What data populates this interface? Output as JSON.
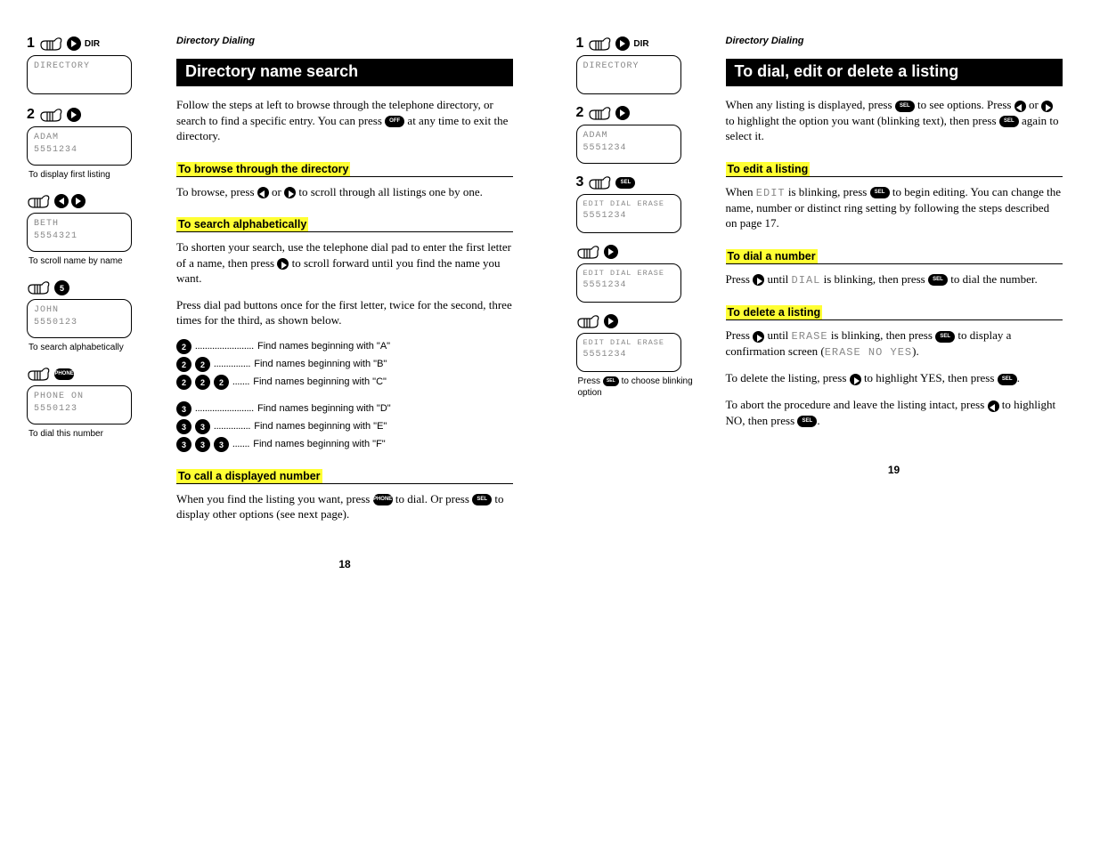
{
  "page_left": {
    "breadcrumb": "Directory Dialing",
    "title": "Directory name search",
    "intro_1": "Follow the steps at left to browse through the telephone directory, or search to find a specific entry. You can press ",
    "intro_off": "OFF",
    "intro_2": " at any time to exit the directory.",
    "sections": {
      "browse": {
        "head": "To browse through the directory",
        "body_1": "To browse, press ",
        "body_2": " or ",
        "body_3": " to scroll through all listings one by one."
      },
      "search": {
        "head": "To search alphabetically",
        "body_a1": "To shorten your search, use the telephone dial pad to enter the first letter of a name, then press ",
        "body_a2": " to scroll forward until you find the name you want.",
        "body_b": "Press dial pad buttons once for the first letter, twice for the second, three times for the third, as shown below.",
        "rows": [
          {
            "keys": [
              "2"
            ],
            "text": "Find names beginning with \"A\""
          },
          {
            "keys": [
              "2",
              "2"
            ],
            "text": "Find names beginning with \"B\""
          },
          {
            "keys": [
              "2",
              "2",
              "2"
            ],
            "text": "Find names beginning with \"C\""
          },
          {
            "keys": [
              "3"
            ],
            "text": "Find names beginning with \"D\""
          },
          {
            "keys": [
              "3",
              "3"
            ],
            "text": "Find names beginning with \"E\""
          },
          {
            "keys": [
              "3",
              "3",
              "3"
            ],
            "text": "Find names beginning with \"F\""
          }
        ]
      },
      "call": {
        "head": "To call a displayed number",
        "body_1": "When you find the listing you want, press ",
        "phone": "PHONE",
        "body_2": " to dial. Or press ",
        "sel": "SEL",
        "body_3": " to display other options (see next page)."
      }
    },
    "margin": [
      {
        "num": "1",
        "icons": "dir",
        "screen": [
          "DIRECTORY",
          ""
        ],
        "cap": ""
      },
      {
        "num": "2",
        "icons": "right",
        "screen": [
          "ADAM",
          "5551234"
        ],
        "cap": "To display first listing"
      },
      {
        "num": "",
        "icons": "lr",
        "screen": [
          "BETH",
          "5554321"
        ],
        "cap": "To scroll name by name"
      },
      {
        "num": "",
        "icons": "key5",
        "screen": [
          "JOHN",
          "5550123"
        ],
        "cap": "To search alphabetically"
      },
      {
        "num": "",
        "icons": "phone",
        "screen": [
          "PHONE ON",
          "5550123"
        ],
        "cap": "To dial this number"
      }
    ],
    "pnum": "18"
  },
  "page_right": {
    "breadcrumb": "Directory Dialing",
    "title": "To dial, edit or delete a listing",
    "intro_1": "When any listing is displayed, press ",
    "sel": "SEL",
    "intro_2": " to see options. Press ",
    "intro_3": " or ",
    "intro_4": " to highlight the option you want (blinking text), then press ",
    "intro_5": " again to select it.",
    "sections": {
      "edit": {
        "head": "To edit a listing",
        "body_1": "When ",
        "lcd1": "EDIT",
        "body_2": " is blinking, press ",
        "body_3": " to begin editing. You can change the name, number or distinct ring setting by following the steps described on page 17."
      },
      "dial": {
        "head": "To dial a number",
        "body_1": "Press ",
        "body_2": " until ",
        "lcd1": "DIAL",
        "body_3": " is blinking, then press ",
        "body_4": " to dial the number."
      },
      "del": {
        "head": "To delete a listing",
        "body_1": "Press ",
        "body_2": " until ",
        "lcd1": "ERASE",
        "body_3": " is blinking, then press ",
        "body_4": " to display a confirmation screen (",
        "lcd2": "ERASE NO YES",
        "body_5": ").",
        "body_6": "To delete the listing, press ",
        "body_7": " to highlight YES, then press ",
        "body_8": ".",
        "body_9": "To abort the procedure and leave the listing intact, press ",
        "body_10": " to highlight NO, then press ",
        "body_11": "."
      }
    },
    "margin": [
      {
        "num": "1",
        "icons": "dir",
        "screen": [
          "DIRECTORY",
          ""
        ],
        "cap": ""
      },
      {
        "num": "2",
        "icons": "right",
        "screen": [
          "ADAM",
          "5551234"
        ],
        "cap": ""
      },
      {
        "num": "3",
        "icons": "sel",
        "screen": [
          "EDIT DIAL ERASE",
          "5551234"
        ],
        "cap": ""
      },
      {
        "num": "",
        "icons": "right",
        "screen": [
          "EDIT DIAL ERASE",
          "5551234"
        ],
        "cap": ""
      },
      {
        "num": "",
        "icons": "right",
        "screen": [
          "EDIT DIAL ERASE",
          "5551234"
        ],
        "cap": "Press SEL to choose blinking option"
      }
    ],
    "margin_cap_pre": "Press ",
    "margin_cap_post": " to choose blinking option",
    "pnum": "19"
  }
}
